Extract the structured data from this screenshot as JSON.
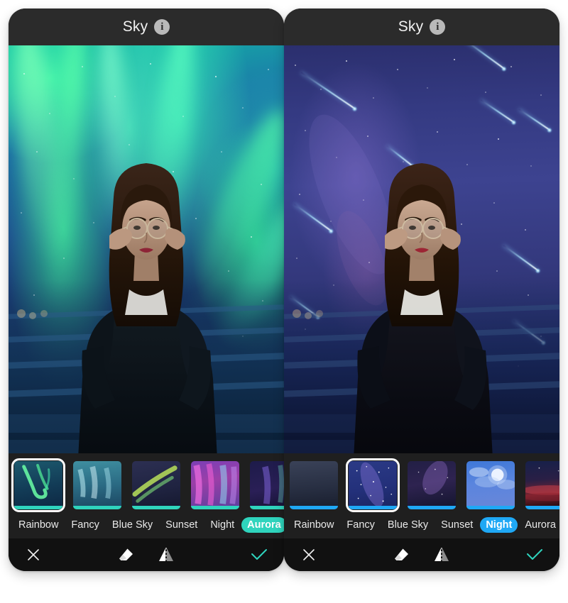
{
  "panels": [
    {
      "id": "left",
      "header": {
        "title": "Sky",
        "info_icon": "info-circle-icon"
      },
      "photo": {
        "subject": "woman with glasses in black leather jacket on balcony at night",
        "sky_effect": "Aurora",
        "description": "green aurora borealis streaks over teal-blue starry sky"
      },
      "accent_color": "#2fd4bd",
      "thumbnails": [
        {
          "name": "Rainbow",
          "selected": true,
          "swatch": "aurora-green-teal"
        },
        {
          "name": "Fancy",
          "selected": false,
          "swatch": "aurora-pale-cyan"
        },
        {
          "name": "BlueSky",
          "selected": false,
          "swatch": "aurora-yellow-green"
        },
        {
          "name": "Sunset",
          "selected": false,
          "swatch": "aurora-magenta-pink"
        },
        {
          "name": "Night",
          "selected": false,
          "swatch": "aurora-deep-violet"
        }
      ],
      "categories": [
        {
          "label": "Rainbow",
          "active": false
        },
        {
          "label": "Fancy",
          "active": false
        },
        {
          "label": "Blue Sky",
          "active": false
        },
        {
          "label": "Sunset",
          "active": false
        },
        {
          "label": "Night",
          "active": false
        },
        {
          "label": "Aurora",
          "active": true
        }
      ],
      "toolbar": {
        "close": "close-x-icon",
        "erase": "eraser-icon",
        "flip": "mirror-flip-icon",
        "confirm": "checkmark-icon",
        "confirm_color": "#2fd4bd"
      }
    },
    {
      "id": "right",
      "header": {
        "title": "Sky",
        "info_icon": "info-circle-icon"
      },
      "photo": {
        "subject": "woman with glasses in black leather jacket on balcony at night",
        "sky_effect": "Night",
        "description": "purple-blue starry night sky with milky way and shooting stars"
      },
      "accent_color": "#1fa8f5",
      "thumbnails": [
        {
          "name": "Rainbow",
          "selected": false,
          "swatch": "night-dim-grey-blue"
        },
        {
          "name": "Fancy",
          "selected": true,
          "swatch": "night-milkyway-blue"
        },
        {
          "name": "BlueSky",
          "selected": false,
          "swatch": "night-dark-purple"
        },
        {
          "name": "Sunset",
          "selected": false,
          "swatch": "night-moon-clouds"
        },
        {
          "name": "Night",
          "selected": false,
          "swatch": "night-red-horizon"
        }
      ],
      "categories": [
        {
          "label": "Rainbow",
          "active": false
        },
        {
          "label": "Fancy",
          "active": false
        },
        {
          "label": "Blue Sky",
          "active": false
        },
        {
          "label": "Sunset",
          "active": false
        },
        {
          "label": "Night",
          "active": true
        },
        {
          "label": "Aurora",
          "active": false
        }
      ],
      "toolbar": {
        "close": "close-x-icon",
        "erase": "eraser-icon",
        "flip": "mirror-flip-icon",
        "confirm": "checkmark-icon",
        "confirm_color": "#2fd4bd"
      }
    }
  ]
}
